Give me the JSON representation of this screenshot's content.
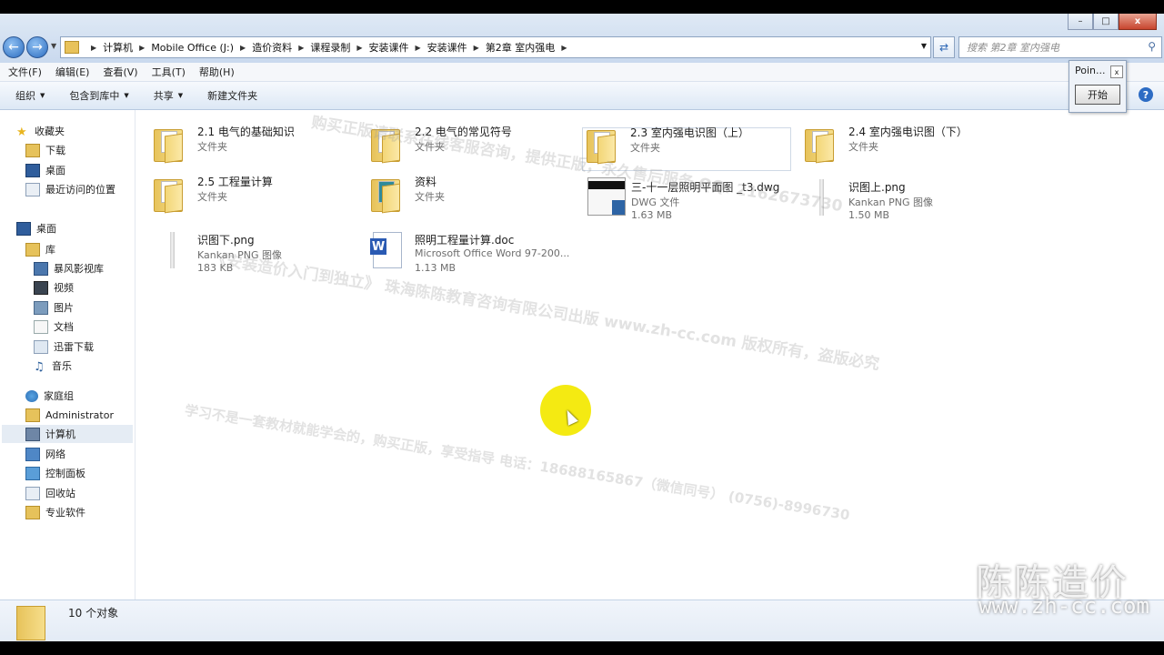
{
  "window": {
    "controls": {
      "minimize": "–",
      "maximize": "□",
      "close": "x"
    }
  },
  "address": {
    "breadcrumbs": [
      "计算机",
      "Mobile Office (J:)",
      "造价资料",
      "课程录制",
      "安装课件",
      "安装课件",
      "第2章 室内强电"
    ],
    "search_placeholder": "搜索 第2章 室内强电"
  },
  "menu": [
    "文件(F)",
    "编辑(E)",
    "查看(V)",
    "工具(T)",
    "帮助(H)"
  ],
  "toolbar": {
    "organize": "组织",
    "include_library": "包含到库中",
    "share": "共享",
    "new_folder": "新建文件夹"
  },
  "sidebar": {
    "favorites": "收藏夹",
    "downloads": "下载",
    "desktop_fav": "桌面",
    "recent": "最近访问的位置",
    "desktop": "桌面",
    "library": "库",
    "baofeng": "暴风影视库",
    "video": "视频",
    "pictures": "图片",
    "documents": "文档",
    "xunlei": "迅雷下载",
    "music": "音乐",
    "homegroup": "家庭组",
    "administrator": "Administrator",
    "computer": "计算机",
    "network": "网络",
    "control_panel": "控制面板",
    "recycle": "回收站",
    "software": "专业软件"
  },
  "files": [
    {
      "name": "2.1 电气的基础知识",
      "type": "文件夹",
      "size": ""
    },
    {
      "name": "2.2 电气的常见符号",
      "type": "文件夹",
      "size": ""
    },
    {
      "name": "2.3 室内强电识图（上）",
      "type": "文件夹",
      "size": ""
    },
    {
      "name": "2.4 室内强电识图（下）",
      "type": "文件夹",
      "size": ""
    },
    {
      "name": "2.5 工程量计算",
      "type": "文件夹",
      "size": ""
    },
    {
      "name": "资料",
      "type": "文件夹",
      "size": ""
    },
    {
      "name": "三-十一层照明平面图 _t3.dwg",
      "type": "DWG 文件",
      "size": "1.63 MB"
    },
    {
      "name": "识图上.png",
      "type": "Kankan PNG 图像",
      "size": "1.50 MB"
    },
    {
      "name": "识图下.png",
      "type": "Kankan PNG 图像",
      "size": "183 KB"
    },
    {
      "name": "照明工程量计算.doc",
      "type": "Microsoft Office Word 97-200...",
      "size": "1.13 MB"
    }
  ],
  "status": {
    "count": "10 个对象"
  },
  "popup": {
    "title": "Poin...",
    "close": "x",
    "start": "开始"
  },
  "watermark": {
    "w1": "购买正版请联系在线客服咨询，提供正版，永久售后服务 QQ: 2162673730",
    "w2": "《安装造价入门到独立》 珠海陈陈教育咨询有限公司出版 www.zh-cc.com 版权所有，盗版必究",
    "w3": "学习不是一套教材就能学会的，购买正版，享受指导  电话：18688165867（微信同号）  (0756)-8996730",
    "brand": "陈陈造价",
    "brand_url": "www.zh-cc.com"
  },
  "colors": {
    "accent": "#2b6cc0",
    "halo": "#f4ea12",
    "folder": "#e7c35b"
  }
}
